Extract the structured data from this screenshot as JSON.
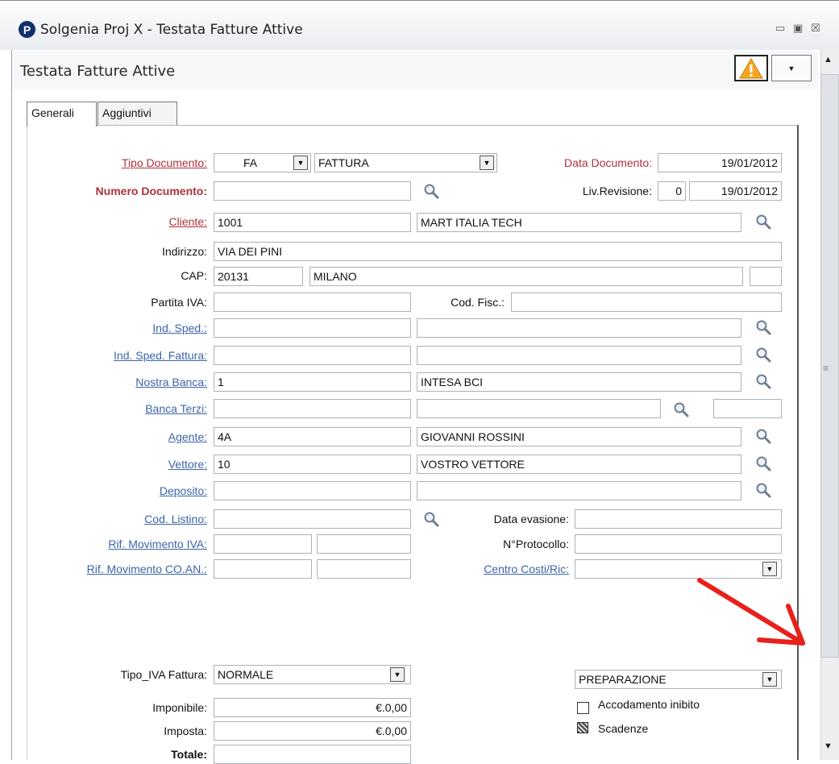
{
  "window": {
    "app_icon_letter": "P",
    "title": "Solgenia Proj X - Testata Fatture Attive",
    "controls": {
      "minimize": "▭",
      "restore": "▣",
      "close": "☒"
    }
  },
  "header": {
    "title": "Testata Fatture Attive",
    "warning_icon": "warning-triangle-icon"
  },
  "tabs": [
    {
      "label": "Generali",
      "active": true
    },
    {
      "label": "Aggiuntivi",
      "active": false
    }
  ],
  "form": {
    "tipo_documento": {
      "label": "Tipo Documento:",
      "code": "FA",
      "desc": "FATTURA"
    },
    "data_documento": {
      "label": "Data Documento:",
      "value": "19/01/2012"
    },
    "numero_documento": {
      "label": "Numero Documento:",
      "value": ""
    },
    "liv_revisione": {
      "label": "Liv.Revisione:",
      "value": "0",
      "date": "19/01/2012"
    },
    "cliente": {
      "label": "Cliente:",
      "code": "1001",
      "name": "MART ITALIA TECH"
    },
    "indirizzo": {
      "label": "Indirizzo:",
      "value": "VIA  DEI PINI"
    },
    "cap": {
      "label": "CAP:",
      "value": "20131",
      "city": "MILANO",
      "prov": ""
    },
    "partita_iva": {
      "label": "Partita IVA:",
      "value": ""
    },
    "cod_fisc": {
      "label": "Cod. Fisc.:",
      "value": ""
    },
    "ind_sped": {
      "label": "Ind. Sped.:",
      "code": "",
      "desc": ""
    },
    "ind_sped_fattura": {
      "label": "Ind. Sped. Fattura:",
      "code": "",
      "desc": ""
    },
    "nostra_banca": {
      "label": "Nostra Banca:",
      "code": "1",
      "desc": "INTESA BCI"
    },
    "banca_terzi": {
      "label": "Banca Terzi:",
      "code": "",
      "desc": "",
      "extra": ""
    },
    "agente": {
      "label": "Agente:",
      "code": "4A",
      "desc": "GIOVANNI ROSSINI"
    },
    "vettore": {
      "label": "Vettore:",
      "code": "10",
      "desc": "VOSTRO VETTORE"
    },
    "deposito": {
      "label": "Deposito:",
      "code": "",
      "desc": ""
    },
    "cod_listino": {
      "label": "Cod. Listino:",
      "value": ""
    },
    "data_evasione": {
      "label": "Data evasione:",
      "value": ""
    },
    "rif_movimento_iva": {
      "label": "Rif. Movimento IVA:",
      "a": "",
      "b": ""
    },
    "n_protocollo": {
      "label": "N°Protocollo:",
      "value": ""
    },
    "rif_movimento_coan": {
      "label": "Rif. Movimento CO.AN.:",
      "a": "",
      "b": ""
    },
    "centro_costi": {
      "label": "Centro Costi/Ric:",
      "value": ""
    },
    "tipo_iva_fattura": {
      "label": "Tipo_IVA Fattura:",
      "value": "NORMALE"
    },
    "stato": {
      "value": "PREPARAZIONE"
    },
    "imponibile": {
      "label": "Imponibile:",
      "value": "€.0,00"
    },
    "imposta": {
      "label": "Imposta:",
      "value": "€.0,00"
    },
    "totale": {
      "label": "Totale:",
      "value": ""
    },
    "accodamento_inibito": {
      "label": "Accodamento inibito",
      "checked": false
    },
    "scadenze": {
      "label": "Scadenze",
      "checked": true
    }
  },
  "colors": {
    "required_label": "#b0303c",
    "link_label": "#3c64a8",
    "annotation_arrow": "#e8201b"
  }
}
